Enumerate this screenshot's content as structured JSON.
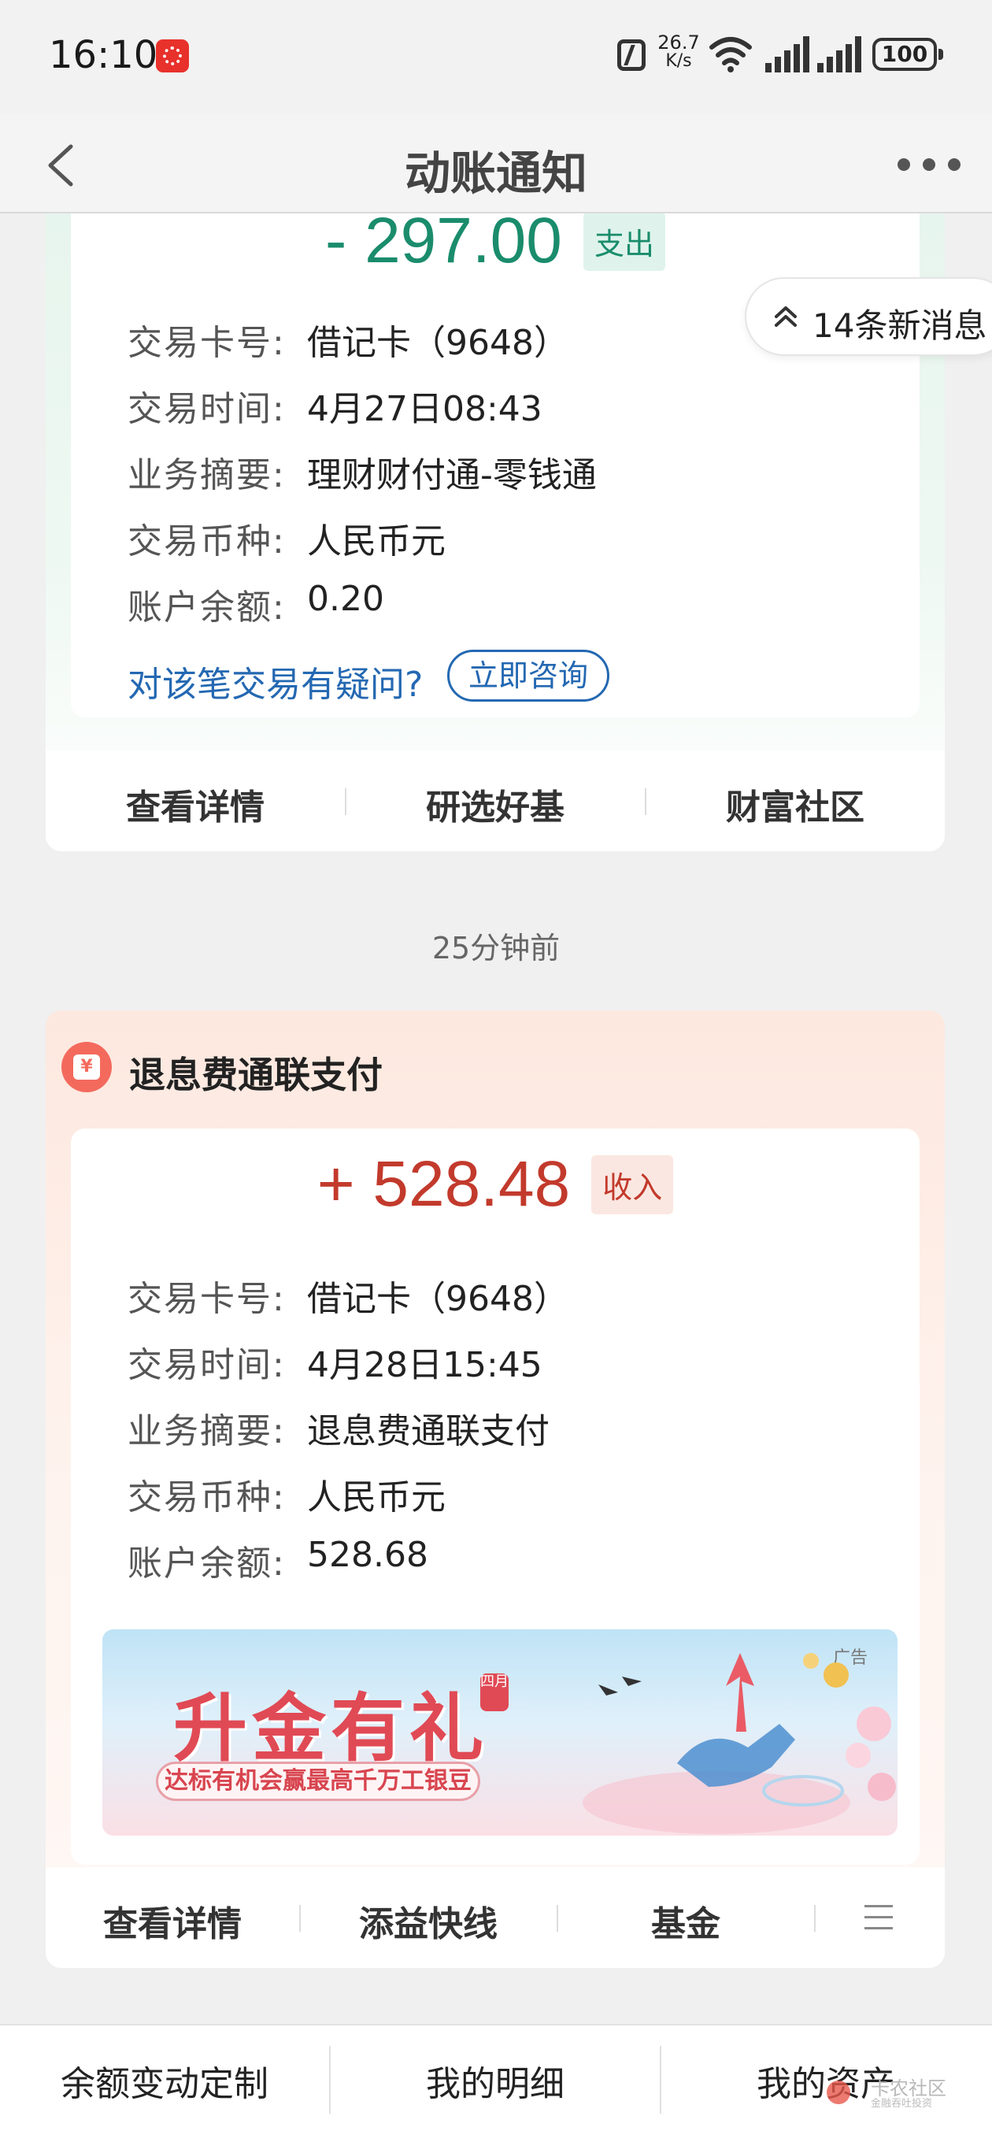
{
  "status_bar": {
    "time": "16:10",
    "net_speed_value": "26.7",
    "net_speed_unit": "K/s",
    "battery": "100",
    "icons": [
      "app-notification-icon",
      "nfc-icon",
      "wifi-icon",
      "signal-icon",
      "signal-icon",
      "battery-icon"
    ]
  },
  "nav": {
    "title": "动账通知",
    "back_icon": "chevron-left-icon",
    "more_icon": "more-dots-icon"
  },
  "new_messages": {
    "label": "14条新消息",
    "icon": "double-chevron-up-icon"
  },
  "transactions": [
    {
      "amount": "- 297.00",
      "type_tag": "支出",
      "fields": [
        {
          "label": "交易卡号:",
          "value": "借记卡（9648）"
        },
        {
          "label": "交易时间:",
          "value": "4月27日08:43"
        },
        {
          "label": "业务摘要:",
          "value": "理财财付通-零钱通"
        },
        {
          "label": "交易币种:",
          "value": "人民币元"
        },
        {
          "label": "账户余额:",
          "value": "0.20"
        }
      ],
      "question": "对该笔交易有疑问?",
      "consult_button": "立即咨询",
      "actions": [
        "查看详情",
        "研选好基",
        "财富社区"
      ]
    },
    {
      "time_ago": "25分钟前",
      "title": "退息费通联支付",
      "icon": "yuan-icon",
      "amount": "+ 528.48",
      "type_tag": "收入",
      "fields": [
        {
          "label": "交易卡号:",
          "value": "借记卡（9648）"
        },
        {
          "label": "交易时间:",
          "value": "4月28日15:45"
        },
        {
          "label": "业务摘要:",
          "value": "退息费通联支付"
        },
        {
          "label": "交易币种:",
          "value": "人民币元"
        },
        {
          "label": "账户余额:",
          "value": "528.68"
        }
      ],
      "ad": {
        "tag": "广告",
        "title": "升金有礼",
        "badge": "四月",
        "subtitle": "达标有机会赢最高千万工银豆"
      },
      "actions": [
        "查看详情",
        "添益快线",
        "基金"
      ],
      "more_icon": "menu-lines-icon"
    }
  ],
  "bottom_bar": {
    "items": [
      "余额变动定制",
      "我的明细",
      "我的资产"
    ]
  },
  "watermark": {
    "main": "卡农社区",
    "sub": "金融吞吐投资"
  },
  "colors": {
    "expense": "#1a8c6c",
    "income": "#c23a2c",
    "link": "#2468b2",
    "page_bg": "#f0f0f0"
  }
}
